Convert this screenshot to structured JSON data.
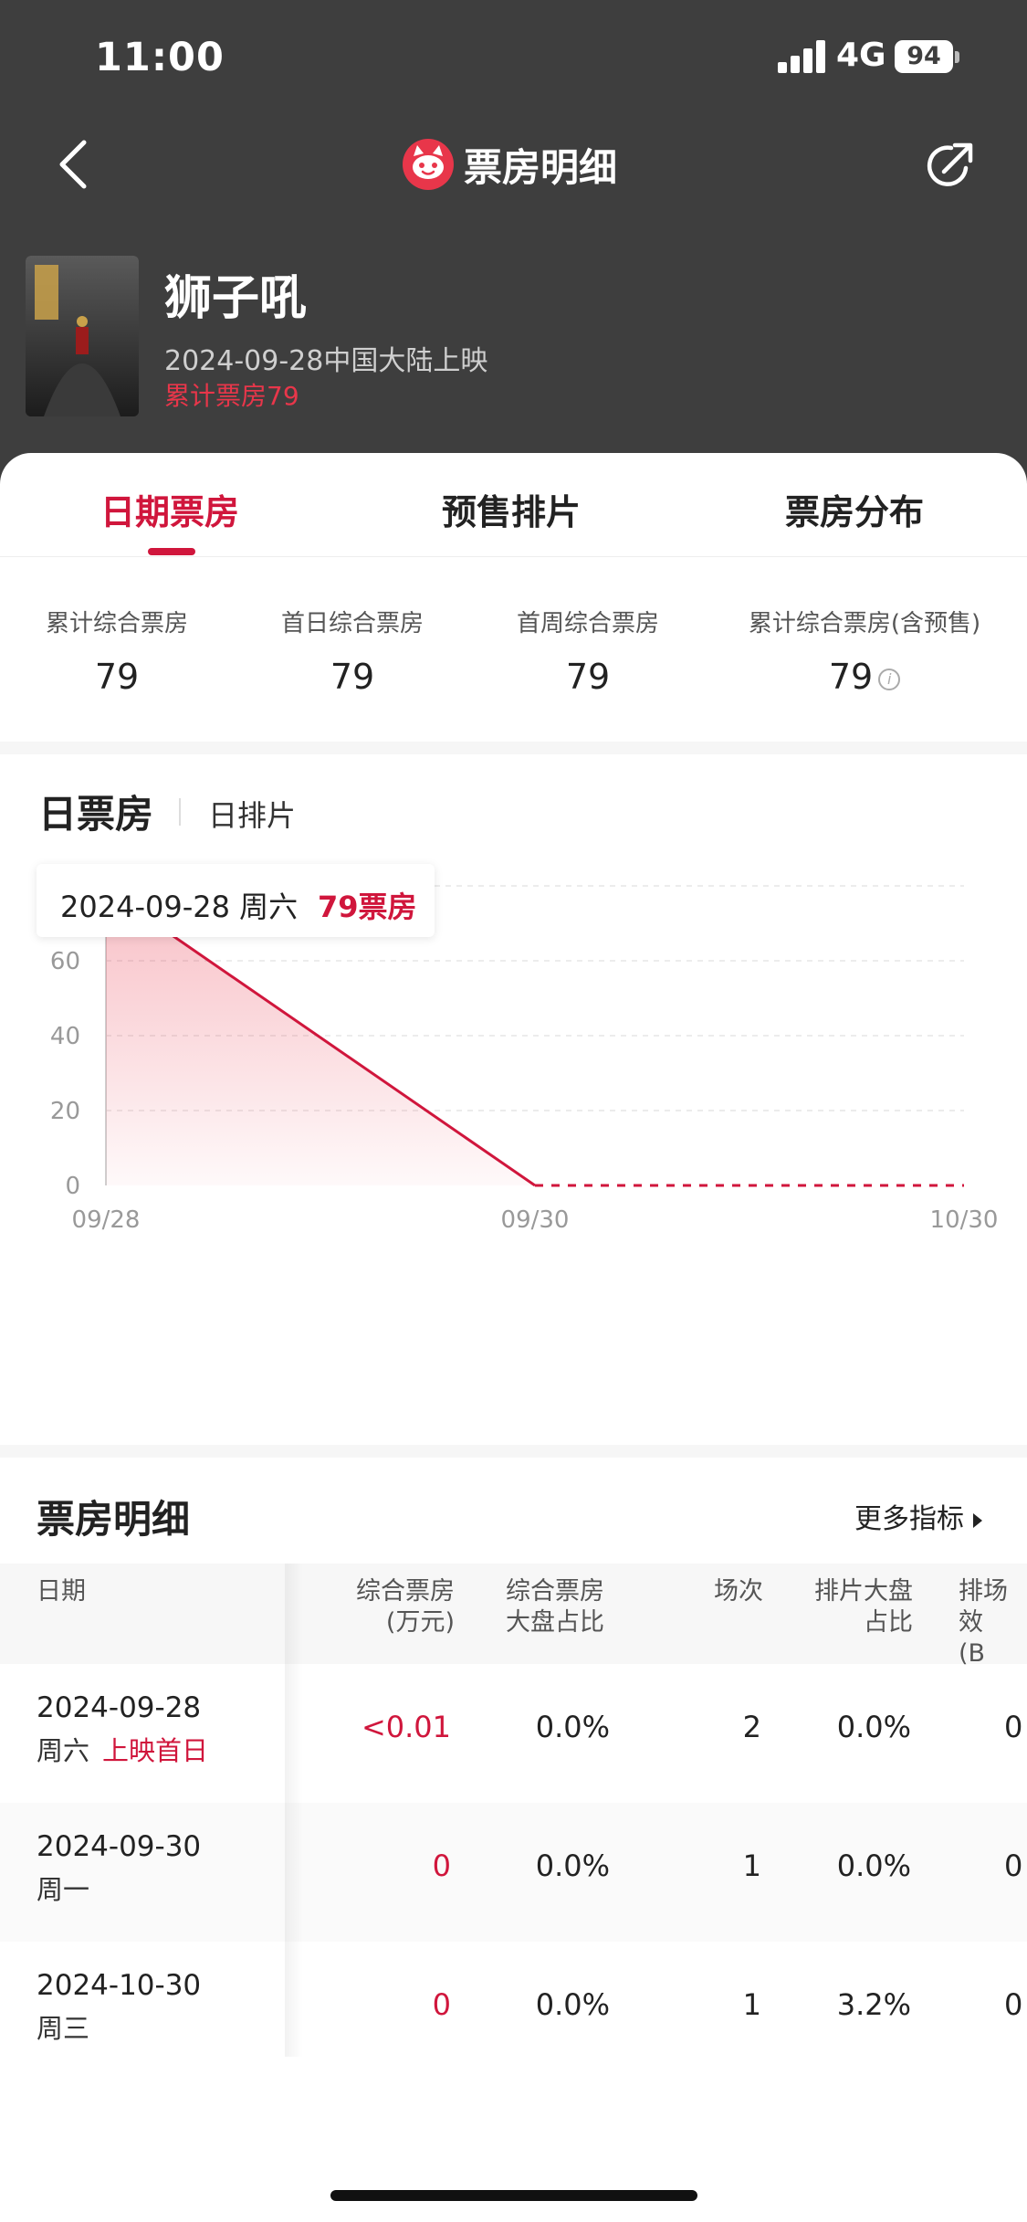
{
  "status_bar": {
    "time": "11:00",
    "network": "4G",
    "battery": "94"
  },
  "nav": {
    "title": "票房明细"
  },
  "movie": {
    "title": "狮子吼",
    "release": "2024-09-28中国大陆上映",
    "total": "累计票房79"
  },
  "tabs": [
    {
      "label": "日期票房",
      "active": true
    },
    {
      "label": "预售排片",
      "active": false
    },
    {
      "label": "票房分布",
      "active": false
    }
  ],
  "stats": [
    {
      "label": "累计综合票房",
      "value": "79"
    },
    {
      "label": "首日综合票房",
      "value": "79"
    },
    {
      "label": "首周综合票房",
      "value": "79"
    },
    {
      "label": "累计综合票房(含预售)",
      "value": "79"
    }
  ],
  "chart": {
    "title": "日票房",
    "subtab": "日排片"
  },
  "tooltip": {
    "date": "2024-09-28 周六",
    "value": "79票房"
  },
  "chart_data": {
    "type": "area",
    "x": [
      "09/28",
      "09/30",
      "10/30"
    ],
    "values": [
      79,
      0,
      0
    ],
    "y_ticks": [
      "80",
      "60",
      "40",
      "20",
      "0"
    ],
    "ylim": [
      0,
      80
    ],
    "grid": true,
    "line_color": "#d0163c"
  },
  "detail": {
    "title": "票房明细",
    "more": "更多指标",
    "headers": [
      "日期",
      "综合票房\n(万元)",
      "综合票房\n大盘占比",
      "场次",
      "排片大盘\n占比",
      "排场效\n(B"
    ],
    "rows": [
      {
        "date": "2024-09-28",
        "weekday": "周六",
        "tag": "上映首日",
        "box": "<0.01",
        "share": "0.0%",
        "shows": "2",
        "sched": "0.0%",
        "eff": "0"
      },
      {
        "date": "2024-09-30",
        "weekday": "周一",
        "tag": "",
        "box": "0",
        "share": "0.0%",
        "shows": "1",
        "sched": "0.0%",
        "eff": "0"
      },
      {
        "date": "2024-10-30",
        "weekday": "周三",
        "tag": "",
        "box": "0",
        "share": "0.0%",
        "shows": "1",
        "sched": "3.2%",
        "eff": "0"
      }
    ]
  }
}
